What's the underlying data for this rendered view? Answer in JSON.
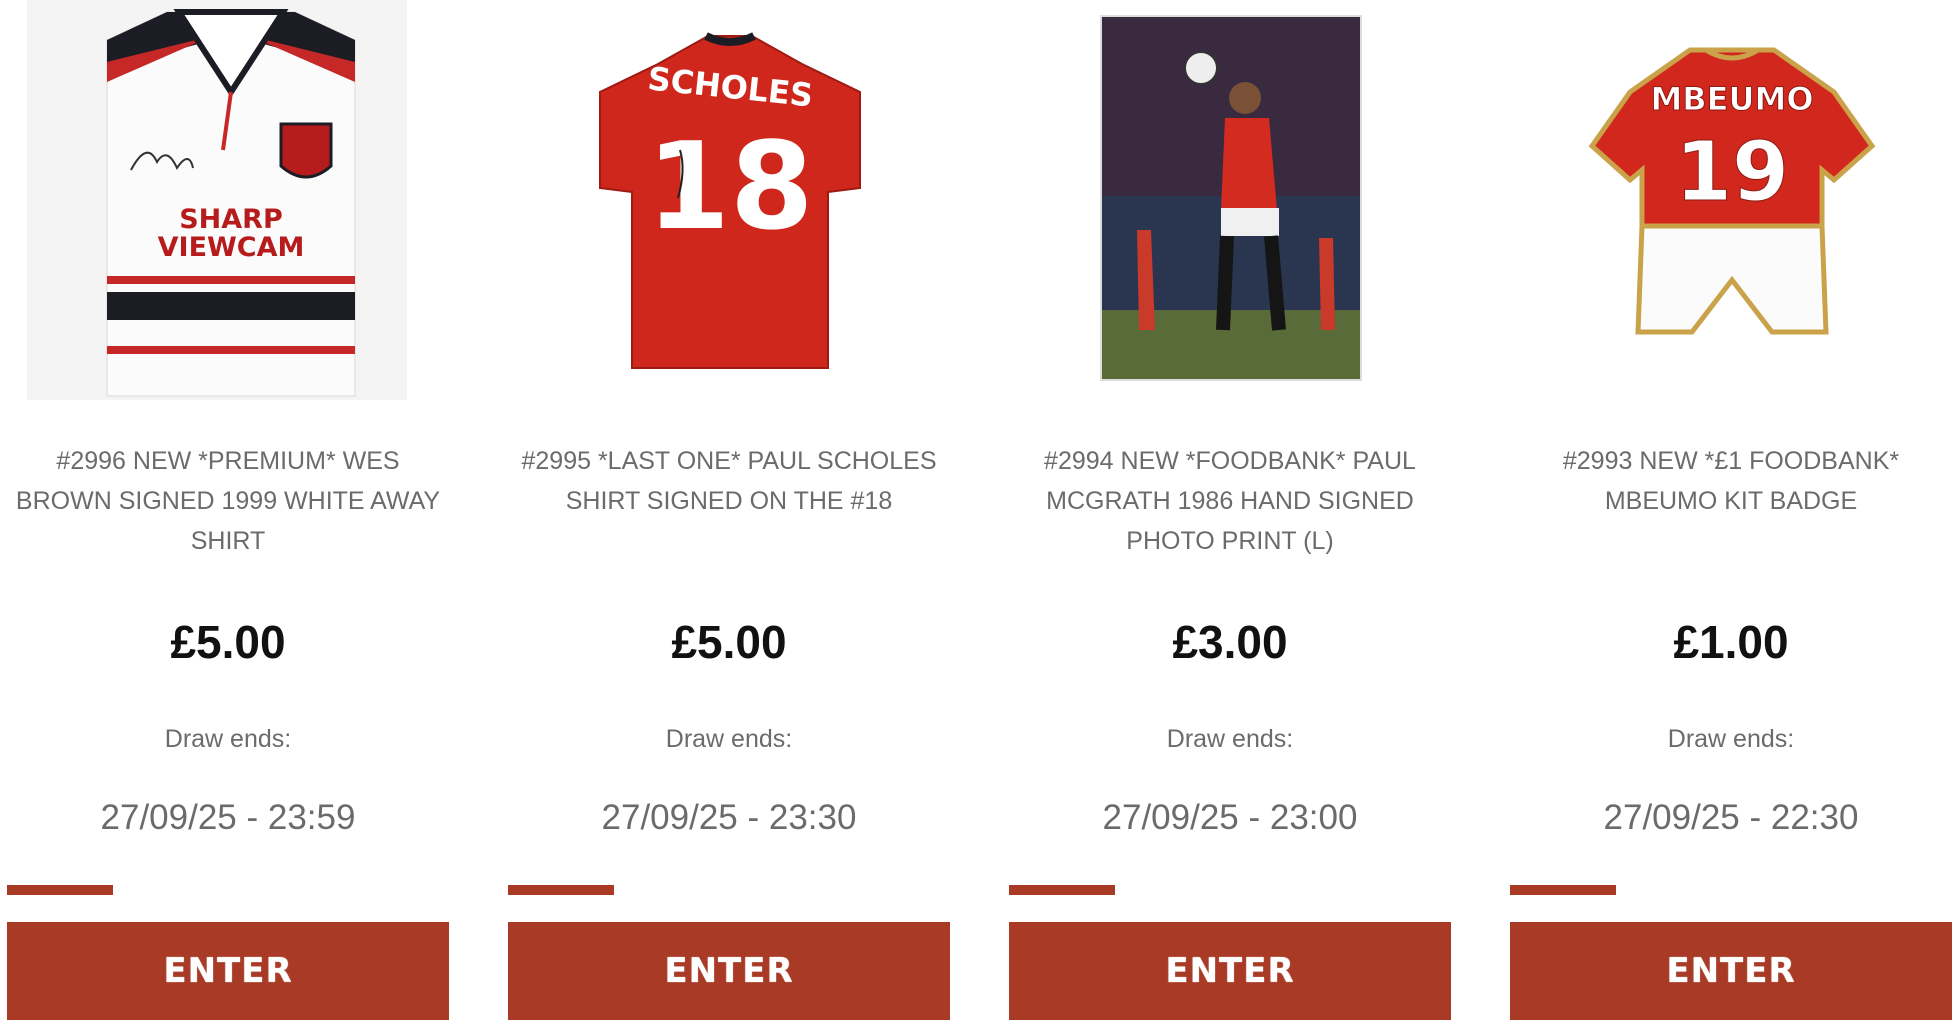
{
  "colors": {
    "accent": "#a83a26",
    "text_muted": "#6b6b6b",
    "price": "#111111"
  },
  "products": [
    {
      "title": "#2996 NEW *PREMIUM* WES BROWN SIGNED 1999 WHITE AWAY SHIRT",
      "price": "£5.00",
      "draw_label": "Draw ends:",
      "draw_end": "27/09/25 - 23:59",
      "progress": 0.24,
      "button_label": "ENTER",
      "image_text": [
        "SHARP",
        "VIEWCAM"
      ]
    },
    {
      "title": "#2995 *LAST ONE* PAUL SCHOLES SHIRT SIGNED ON THE #18",
      "price": "£5.00",
      "draw_label": "Draw ends:",
      "draw_end": "27/09/25 - 23:30",
      "progress": 0.24,
      "button_label": "ENTER",
      "image_text": [
        "SCHOLES",
        "18"
      ]
    },
    {
      "title": "#2994 NEW *FOODBANK* PAUL MCGRATH 1986 HAND SIGNED PHOTO PRINT (L)",
      "price": "£3.00",
      "draw_label": "Draw ends:",
      "draw_end": "27/09/25 - 23:00",
      "progress": 0.24,
      "button_label": "ENTER"
    },
    {
      "title": "#2993 NEW *£1 FOODBANK* MBEUMO KIT BADGE",
      "price": "£1.00",
      "draw_label": "Draw ends:",
      "draw_end": "27/09/25 - 22:30",
      "progress": 0.24,
      "button_label": "ENTER",
      "image_text": [
        "MBEUMO",
        "19"
      ]
    }
  ]
}
